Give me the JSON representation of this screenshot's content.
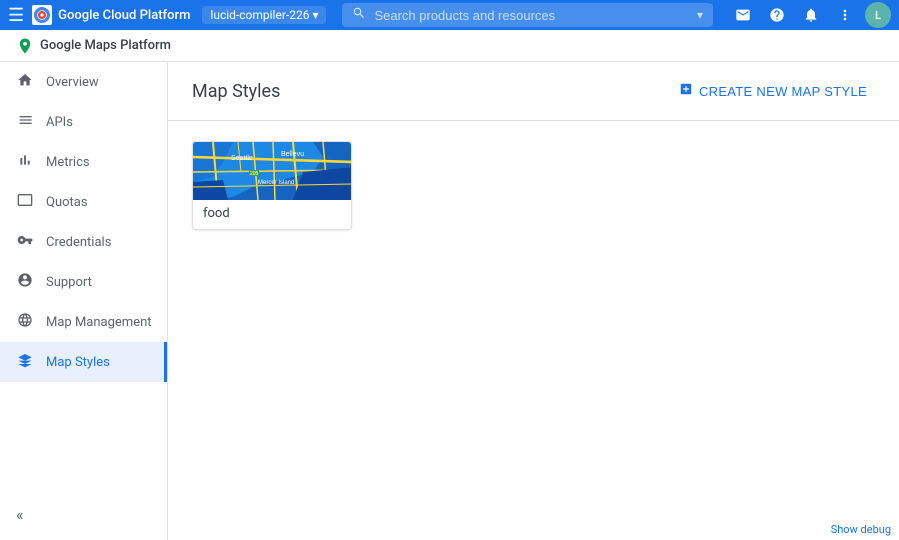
{
  "topbar": {
    "title": "Google Cloud Platform",
    "project": "lucid-compiler-226",
    "search_placeholder": "Search products and resources",
    "dropdown_arrow": "▾"
  },
  "subbar": {
    "title": "Google Maps Platform"
  },
  "sidebar": {
    "items": [
      {
        "id": "overview",
        "label": "Overview",
        "icon": "home"
      },
      {
        "id": "apis",
        "label": "APIs",
        "icon": "grid"
      },
      {
        "id": "metrics",
        "label": "Metrics",
        "icon": "bar-chart"
      },
      {
        "id": "quotas",
        "label": "Quotas",
        "icon": "monitor"
      },
      {
        "id": "credentials",
        "label": "Credentials",
        "icon": "key"
      },
      {
        "id": "support",
        "label": "Support",
        "icon": "person"
      },
      {
        "id": "map-management",
        "label": "Map Management",
        "icon": "layers"
      },
      {
        "id": "map-styles",
        "label": "Map Styles",
        "icon": "palette",
        "active": true
      }
    ]
  },
  "content": {
    "title": "Map Styles",
    "create_button_label": "CREATE NEW MAP STYLE",
    "cards": [
      {
        "id": "food-style",
        "label": "food"
      }
    ]
  },
  "bottom": {
    "debug_label": "Show debug"
  },
  "icons": {
    "menu": "☰",
    "search": "🔍",
    "email": "✉",
    "help": "?",
    "bell": "🔔",
    "more": "⋮",
    "maps_pin": "📍",
    "add": "+",
    "collapse": "«"
  }
}
